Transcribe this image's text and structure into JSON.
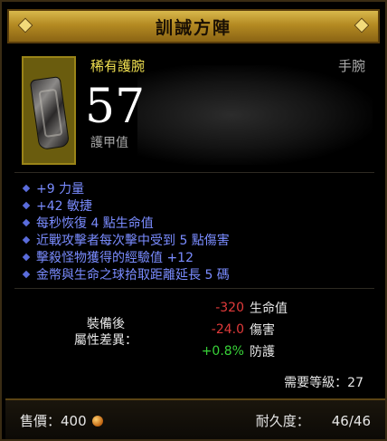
{
  "title": "訓誡方陣",
  "item": {
    "name": "稀有護腕",
    "type": "手腕",
    "armor_value": "57",
    "armor_label": "護甲值"
  },
  "stats": [
    "+9 力量",
    "+42 敏捷",
    "每秒恢復 4 點生命值",
    "近戰攻擊者每次擊中受到 5 點傷害",
    "擊殺怪物獲得的經驗值 +12",
    "金幣與生命之球拾取距離延長 5 碼"
  ],
  "compare": {
    "label_line1": "裝備後",
    "label_line2": "屬性差異：",
    "rows": [
      {
        "value": "-320",
        "name": "生命值",
        "color": "#e03a3a"
      },
      {
        "value": "-24.0",
        "name": "傷害",
        "color": "#e03a3a"
      },
      {
        "value": "+0.8%",
        "name": "防護",
        "color": "#38d238"
      }
    ]
  },
  "required_level": "需要等級：27",
  "footer": {
    "sell_label": "售價：400",
    "durability_label": "耐久度：",
    "durability_value": "46/46"
  },
  "colors": {
    "rare_yellow": "#f0e050",
    "magic_blue": "#7a8cff",
    "title_gold": "#b48a22"
  }
}
